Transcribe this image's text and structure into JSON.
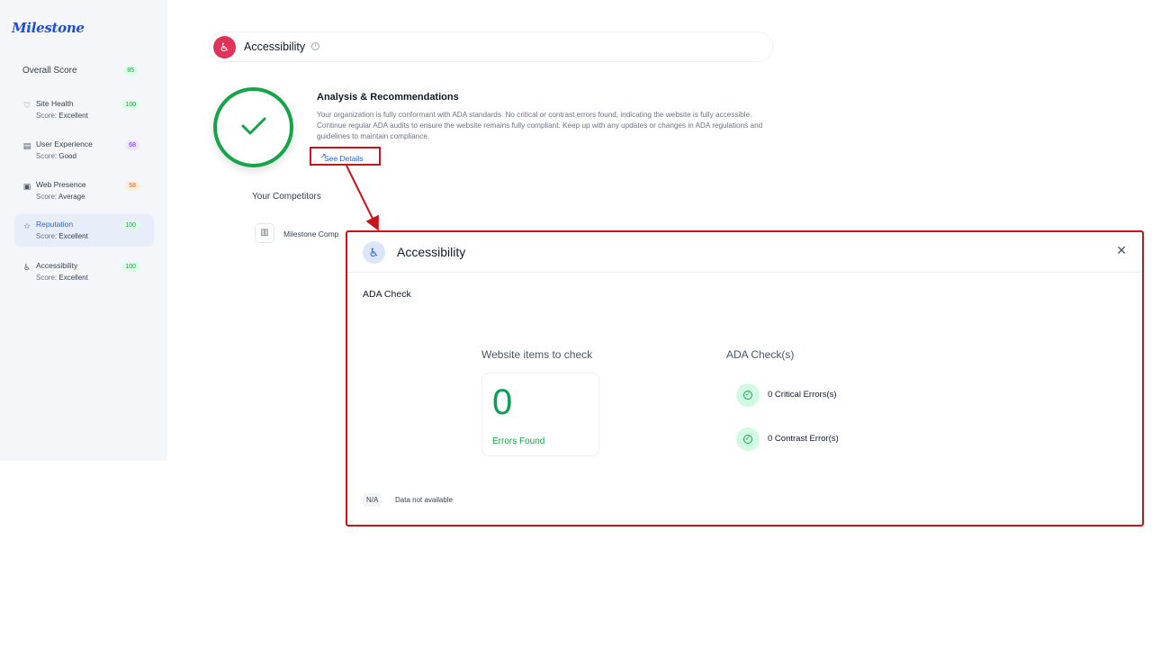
{
  "sidebar": {
    "logo": "Milestone",
    "overall": {
      "label": "Overall Score",
      "value": "85"
    },
    "items": [
      {
        "title": "Site Health",
        "score_label": "Score:",
        "score": "Excellent",
        "value": "100",
        "icon": "heart-icon"
      },
      {
        "title": "User Experience",
        "score_label": "Score:",
        "score": "Good",
        "value": "68",
        "icon": "layout-icon"
      },
      {
        "title": "Web Presence",
        "score_label": "Score:",
        "score": "Average",
        "value": "58",
        "icon": "globe-icon"
      },
      {
        "title": "Reputation",
        "score_label": "Score:",
        "score": "Excellent",
        "value": "100",
        "icon": "star-icon"
      },
      {
        "title": "Accessibility",
        "score_label": "Score:",
        "score": "Excellent",
        "value": "100",
        "icon": "accessibility-icon"
      }
    ]
  },
  "main": {
    "title": "Accessibility",
    "analysis_title": "Analysis & Recommendations",
    "analysis_text": "Your organization is fully conformant with ADA standards. No critical or contrast errors found, indicating the website is fully accessible. Continue regular ADA audits to ensure the website remains fully compliant. Keep up with any updates or changes in ADA regulations and guidelines to maintain compliance.",
    "see_details": "See Details",
    "competitors_title": "Your Competitors",
    "competitor_name": "Milestone Comp"
  },
  "modal": {
    "title": "Accessibility",
    "section": "ADA Check",
    "website_items_title": "Website items to check",
    "errors_count": "0",
    "errors_label": "Errors Found",
    "ada_checks_title": "ADA Check(s)",
    "checks": [
      {
        "label": "0 Critical Errors(s)"
      },
      {
        "label": "0 Contrast Error(s)"
      }
    ],
    "na_badge": "N/A",
    "na_text": "Data not available"
  },
  "colors": {
    "accent_blue": "#2563eb",
    "success_green": "#16a34a",
    "accessibility_pink": "#e0335a",
    "highlight_red": "#c8141b"
  }
}
